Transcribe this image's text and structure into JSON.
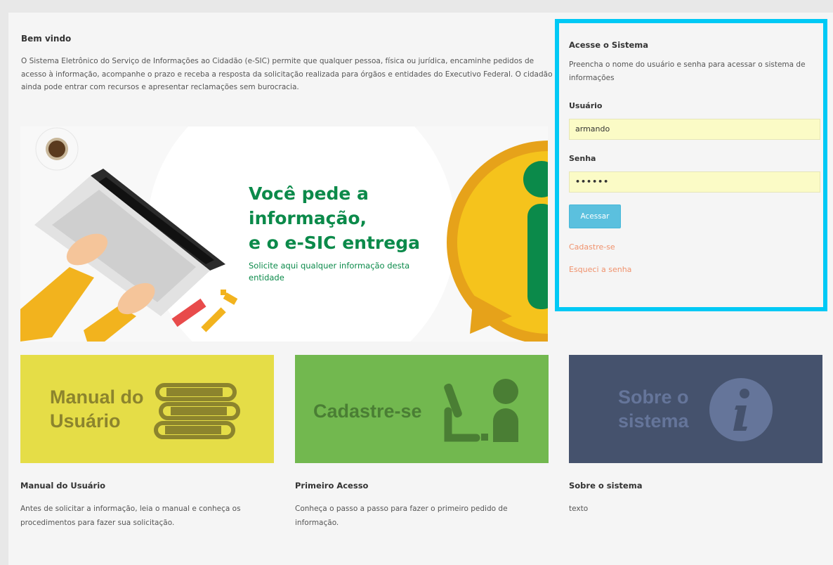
{
  "welcome": {
    "title": "Bem vindo",
    "text": "O Sistema Eletrônico do Serviço de Informações ao Cidadão (e-SIC) permite que qualquer pessoa, física ou jurídica, encaminhe pedidos de acesso à informação, acompanhe o prazo e receba a resposta da solicitação realizada para órgãos e entidades do Executivo Federal. O cidadão ainda pode entrar com recursos e apresentar reclamações sem burocracia."
  },
  "banner": {
    "line1": "Você pede a",
    "line2": "informação,",
    "line3": "e o e-SIC entrega",
    "subtitle": "Solicite aqui qualquer informação desta entidade"
  },
  "login": {
    "title": "Acesse o Sistema",
    "description": "Preencha o nome do usuário e senha para acessar o sistema de informações",
    "user_label": "Usuário",
    "user_value": "armando",
    "password_label": "Senha",
    "password_value": "••••••",
    "submit_label": "Acessar",
    "register_link": "Cadastre-se",
    "forgot_link": "Esqueci a senha"
  },
  "tiles": [
    {
      "label_line1": "Manual do",
      "label_line2": "Usuário",
      "color": "#e5dd47",
      "icon": "books-icon"
    },
    {
      "label": "Cadastre-se",
      "color": "#72b84f",
      "icon": "user-register-icon"
    },
    {
      "label_line1": "Sobre o",
      "label_line2": "sistema",
      "color": "#45526d",
      "icon": "info-icon"
    }
  ],
  "cards": [
    {
      "title": "Manual do Usuário",
      "text": "Antes de solicitar a informação, leia o manual e conheça os procedimentos para fazer sua solicitação."
    },
    {
      "title": "Primeiro Acesso",
      "text": "Conheça o passo a passo para fazer o primeiro pedido de informação."
    },
    {
      "title": "Sobre o sistema",
      "text": "texto"
    }
  ],
  "colors": {
    "accent_border": "#00c9f5",
    "button": "#5bc0de",
    "link": "#f0926d",
    "banner_green": "#0b8a4a"
  }
}
